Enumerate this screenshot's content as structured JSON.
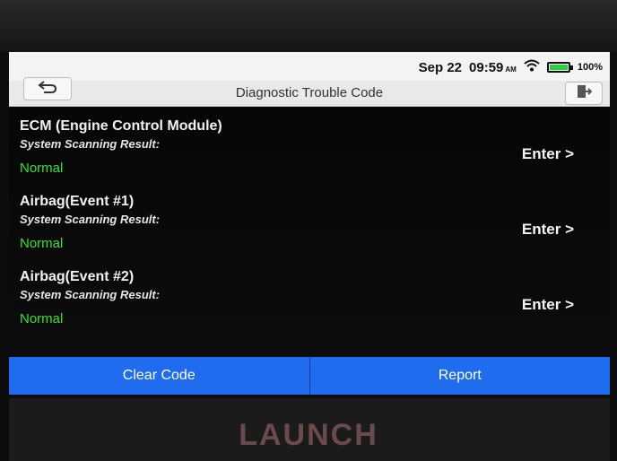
{
  "status_bar": {
    "date": "Sep 22",
    "time": "09:59",
    "ampm": "AM",
    "battery": "100%"
  },
  "title_bar": {
    "title": "Diagnostic Trouble Code",
    "back_icon": "back-arrow-icon",
    "exit_icon": "exit-door-icon"
  },
  "modules": [
    {
      "name": "ECM (Engine Control Module)",
      "scan_label": "System Scanning Result:",
      "status": "Normal",
      "enter": "Enter >"
    },
    {
      "name": "Airbag(Event #1)",
      "scan_label": "System Scanning Result:",
      "status": "Normal",
      "enter": "Enter >"
    },
    {
      "name": "Airbag(Event #2)",
      "scan_label": "System Scanning Result:",
      "status": "Normal",
      "enter": "Enter >"
    }
  ],
  "actions": {
    "clear_code": "Clear Code",
    "report": "Report"
  },
  "device": {
    "brand": "LAUNCH"
  },
  "colors": {
    "accent": "#1f6dee",
    "status_ok": "#37e22e"
  }
}
